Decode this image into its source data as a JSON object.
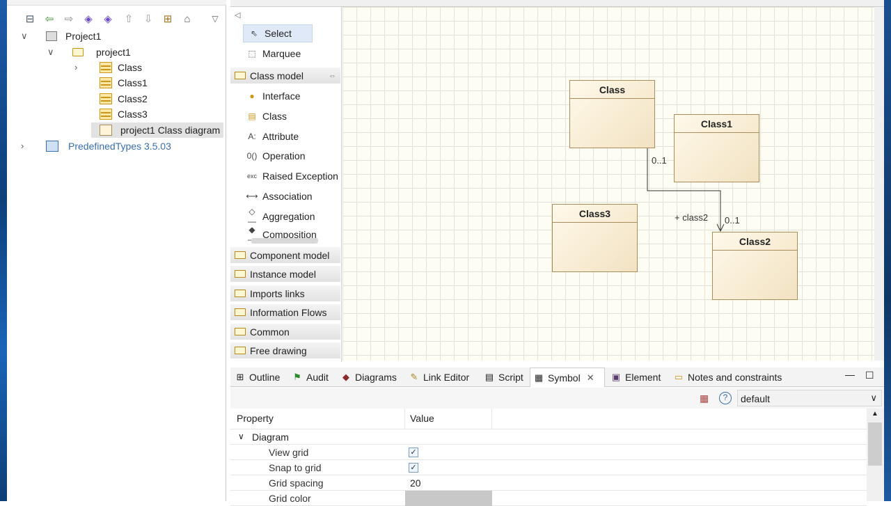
{
  "explorer": {
    "tree": [
      {
        "label": "Project1"
      },
      {
        "label": "project1"
      },
      {
        "label": "Class"
      },
      {
        "label": "Class1"
      },
      {
        "label": "Class2"
      },
      {
        "label": "Class3"
      },
      {
        "label": "project1 Class diagram"
      },
      {
        "label": "PredefinedTypes 3.5.03"
      }
    ]
  },
  "palette": {
    "tools": [
      {
        "label": "Select",
        "icon": "cursor-icon"
      },
      {
        "label": "Marquee",
        "icon": "marquee-icon"
      }
    ],
    "drawer_open": "Class model",
    "items": [
      {
        "label": "Interface",
        "icon": "interface-icon"
      },
      {
        "label": "Class",
        "icon": "class-icon"
      },
      {
        "label": "Attribute",
        "icon": "attribute-icon"
      },
      {
        "label": "Operation",
        "icon": "operation-icon"
      },
      {
        "label": "Raised Exception",
        "icon": "exception-icon"
      },
      {
        "label": "Association",
        "icon": "association-icon"
      },
      {
        "label": "Aggregation",
        "icon": "aggregation-icon"
      },
      {
        "label": "Composition",
        "icon": "composition-icon"
      }
    ],
    "drawers": [
      "Component model",
      "Instance model",
      "Imports links",
      "Information Flows",
      "Common",
      "Free drawing"
    ]
  },
  "diagram": {
    "classes": [
      "Class",
      "Class1",
      "Class3",
      "Class2"
    ],
    "assoc": {
      "source_mult": "0..1",
      "role": "+ class2",
      "target_mult": "0..1"
    }
  },
  "views": {
    "tabs": [
      "Outline",
      "Audit",
      "Diagrams",
      "Link Editor",
      "Script",
      "Symbol",
      "Element",
      "Notes and constraints"
    ],
    "symbol_select": "default",
    "columns": {
      "property": "Property",
      "value": "Value"
    },
    "group": "Diagram",
    "rows": [
      {
        "name": "View grid",
        "checked": true
      },
      {
        "name": "Snap to grid",
        "checked": true
      },
      {
        "name": "Grid spacing",
        "value": "20"
      },
      {
        "name": "Grid color",
        "value": ""
      }
    ]
  }
}
